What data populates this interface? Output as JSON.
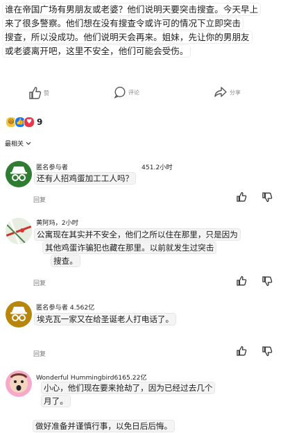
{
  "post": {
    "lines": [
      "谁在帝国广场有男朋友或老婆？他们说明天要突击搜查。今天早上",
      "来了很多警察。他们想在没有搜查令或许可的情况下立即突击",
      "搜查，所以没成功。他们说明天会再来。姐妹，先让你的男朋友",
      "或老婆离开吧，这里不安全，他们可能会受伤。"
    ]
  },
  "actions": {
    "like": "赞",
    "comment": "评论",
    "share": "分享"
  },
  "reactions": {
    "count": "9"
  },
  "sort_label": "最相关",
  "comments": [
    {
      "name": "匿名参与者",
      "meta": "451.2小时",
      "lines": [
        "还有人招鸡蛋加工工人吗？"
      ],
      "reply": "回复"
    },
    {
      "name": "黄阿玛，2小时",
      "meta": "",
      "lines": [
        "公寓现在其实并不安全，他们之所以住在那里，只是因为",
        "其他鸡蛋诈骗犯也藏在那里。以前就发生过突击",
        "搜查。"
      ],
      "reply": "回复"
    },
    {
      "name": "匿名参与者 4.562亿",
      "meta": "",
      "lines": [
        "埃克瓦一家又在给圣诞老人打电话了。"
      ],
      "reply": "回复"
    },
    {
      "name": "Wonderful Hummingbird6165.22亿",
      "meta": "",
      "lines": [
        "小心，他们现在要来抢劫了，因为已经过去几个",
        "月了。"
      ],
      "reply": ""
    }
  ],
  "trailing_text": "做好准备并谨慎行事，以免日后后悔。",
  "colors": {
    "anon_green": "#2e7d32",
    "anon_gold": "#b8860b",
    "pink": "#f8a8c8"
  }
}
